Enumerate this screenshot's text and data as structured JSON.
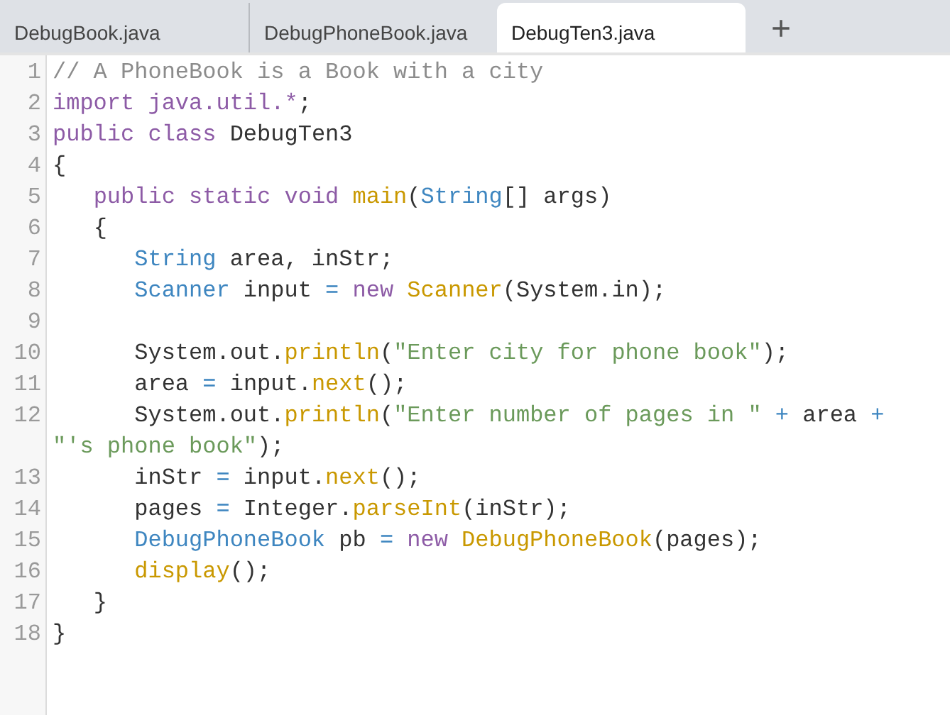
{
  "tabs": [
    {
      "label": "DebugBook.java",
      "selected": false
    },
    {
      "label": "DebugPhoneBook.java",
      "selected": false
    },
    {
      "label": "DebugTen3.java",
      "selected": true
    }
  ],
  "new_tab_button": "+",
  "editor": {
    "lines": [
      {
        "number": "1",
        "tokens": [
          {
            "kind": "comment",
            "text": "// A PhoneBook is a Book with a city"
          }
        ]
      },
      {
        "number": "2",
        "tokens": [
          {
            "kind": "keyword",
            "text": "import java.util.*"
          },
          {
            "kind": "plain",
            "text": ";"
          }
        ]
      },
      {
        "number": "3",
        "tokens": [
          {
            "kind": "keyword",
            "text": "public class "
          },
          {
            "kind": "plain",
            "text": "DebugTen3"
          }
        ]
      },
      {
        "number": "4",
        "tokens": [
          {
            "kind": "plain",
            "text": "{"
          }
        ]
      },
      {
        "number": "5",
        "tokens": [
          {
            "kind": "keyword",
            "text": "   public static void "
          },
          {
            "kind": "function",
            "text": "main"
          },
          {
            "kind": "plain",
            "text": "("
          },
          {
            "kind": "type",
            "text": "String"
          },
          {
            "kind": "plain",
            "text": "[] args)"
          }
        ]
      },
      {
        "number": "6",
        "tokens": [
          {
            "kind": "plain",
            "text": "   {"
          }
        ]
      },
      {
        "number": "7",
        "tokens": [
          {
            "kind": "type",
            "text": "      String"
          },
          {
            "kind": "plain",
            "text": " area, inStr;"
          }
        ]
      },
      {
        "number": "8",
        "tokens": [
          {
            "kind": "type",
            "text": "      Scanner"
          },
          {
            "kind": "plain",
            "text": " input "
          },
          {
            "kind": "operator",
            "text": "= "
          },
          {
            "kind": "keyword",
            "text": "new "
          },
          {
            "kind": "function",
            "text": "Scanner"
          },
          {
            "kind": "plain",
            "text": "(System.in);"
          }
        ]
      },
      {
        "number": "9"
      },
      {
        "number": "10",
        "tokens": [
          {
            "kind": "plain",
            "text": "      System.out."
          },
          {
            "kind": "function",
            "text": "println"
          },
          {
            "kind": "plain",
            "text": "("
          },
          {
            "kind": "string",
            "text": "\"Enter city for phone book\""
          },
          {
            "kind": "plain",
            "text": ");"
          }
        ]
      },
      {
        "number": "11",
        "tokens": [
          {
            "kind": "plain",
            "text": "      area "
          },
          {
            "kind": "operator",
            "text": "="
          },
          {
            "kind": "plain",
            "text": " input."
          },
          {
            "kind": "function",
            "text": "next"
          },
          {
            "kind": "plain",
            "text": "();"
          }
        ]
      },
      {
        "number": "12",
        "tokens": [
          {
            "kind": "plain",
            "text": "      System.out."
          },
          {
            "kind": "function",
            "text": "println"
          },
          {
            "kind": "plain",
            "text": "("
          },
          {
            "kind": "string",
            "text": "\"Enter number of pages in \" "
          },
          {
            "kind": "operator",
            "text": "+"
          },
          {
            "kind": "plain",
            "text": " area "
          },
          {
            "kind": "operator",
            "text": "+ "
          },
          {
            "kind": "string",
            "text": "\"'s phone book\""
          },
          {
            "kind": "plain",
            "text": ");"
          }
        ]
      },
      {
        "number": "13",
        "tokens": [
          {
            "kind": "plain",
            "text": "      inStr "
          },
          {
            "kind": "operator",
            "text": "="
          },
          {
            "kind": "plain",
            "text": " input."
          },
          {
            "kind": "function",
            "text": "next"
          },
          {
            "kind": "plain",
            "text": "();"
          }
        ]
      },
      {
        "number": "14",
        "tokens": [
          {
            "kind": "plain",
            "text": "      pages "
          },
          {
            "kind": "operator",
            "text": "="
          },
          {
            "kind": "plain",
            "text": " Integer."
          },
          {
            "kind": "function",
            "text": "parseInt"
          },
          {
            "kind": "plain",
            "text": "(inStr);"
          }
        ]
      },
      {
        "number": "15",
        "tokens": [
          {
            "kind": "type",
            "text": "      DebugPhoneBook"
          },
          {
            "kind": "plain",
            "text": " pb "
          },
          {
            "kind": "operator",
            "text": "= "
          },
          {
            "kind": "keyword",
            "text": "new "
          },
          {
            "kind": "function",
            "text": "DebugPhoneBook"
          },
          {
            "kind": "plain",
            "text": "(pages);"
          }
        ]
      },
      {
        "number": "16",
        "tokens": [
          {
            "kind": "function",
            "text": "      display"
          },
          {
            "kind": "plain",
            "text": "();"
          }
        ]
      },
      {
        "number": "17",
        "tokens": [
          {
            "kind": "plain",
            "text": "   }"
          }
        ]
      },
      {
        "number": "18",
        "tokens": [
          {
            "kind": "plain",
            "text": "}"
          }
        ]
      }
    ]
  }
}
